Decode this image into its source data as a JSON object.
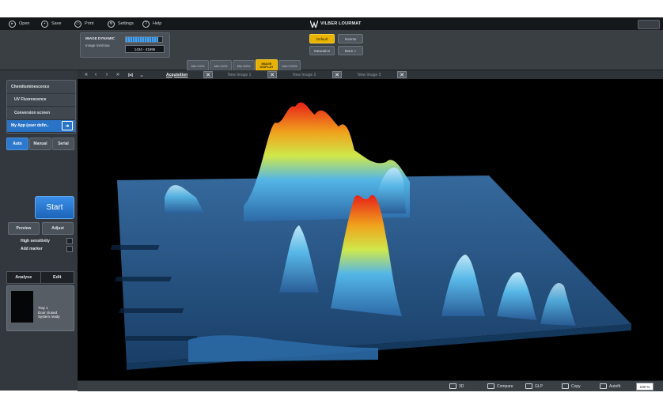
{
  "menu": {
    "items": [
      "Open",
      "Save",
      "Print",
      "Settings",
      "Help"
    ],
    "brand": "VILBER LOURMAT"
  },
  "dynamic": {
    "title": "IMAGE DYNAMIC",
    "sub": "Image min/max",
    "range": "1434 - 41695",
    "fill_fraction": 0.9
  },
  "zoom_buttons": [
    "Min+20%",
    "Min+40%",
    "Min+60%",
    "IMAGE DISPLAY",
    "Min+100%"
  ],
  "display": {
    "default": "Default",
    "inverse": "Inverse",
    "saturation": "Saturation",
    "more": "More >"
  },
  "modes": [
    "Chemiluminescence",
    "UV Fluorescence",
    "Conversion screen",
    "My App (user defin.."
  ],
  "acq_modes": [
    "Auto",
    "Manual",
    "Serial"
  ],
  "start": "Start",
  "preview": "Preview",
  "adjust": "Adjust",
  "options": [
    "High sensitivity",
    "Add marker"
  ],
  "bottom_tabs": [
    "Analyse",
    "Edit"
  ],
  "tray": {
    "line1": "Tray 1",
    "line2": "Door closed",
    "line3": "System ready"
  },
  "image_tabs": [
    "Acquisition",
    "New Image 1",
    "New Image 2",
    "New Image 3"
  ],
  "nav": [
    "«",
    "‹",
    "›",
    "»",
    "⋈",
    "⌄"
  ],
  "bottom_buttons": [
    "3D",
    "Compare",
    "GLP",
    "Copy",
    "Autofit"
  ],
  "zoom_value": "100 %",
  "colors": {
    "accent": "#2a74c7",
    "highlight": "#e9b400"
  }
}
